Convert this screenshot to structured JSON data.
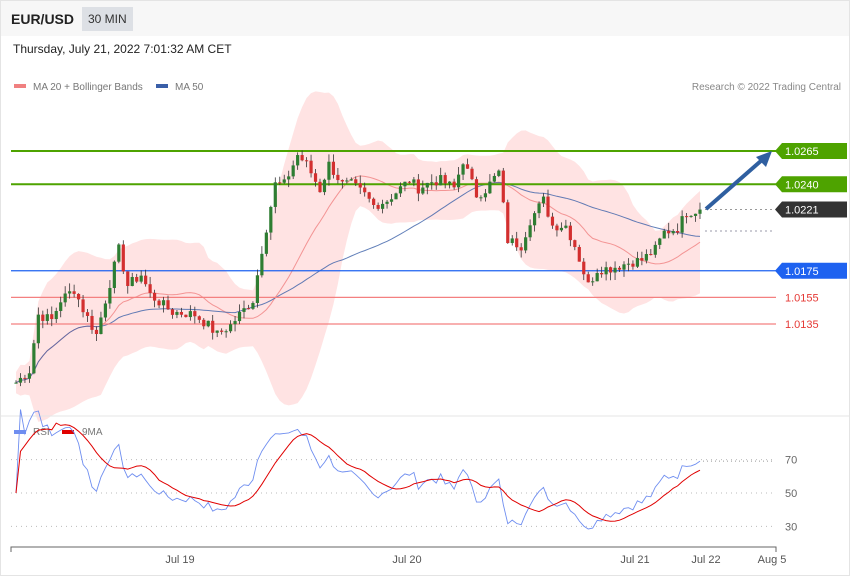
{
  "header": {
    "symbol": "EUR/USD",
    "timeframe": "30 MIN",
    "datetime": "Thursday, July 21, 2022 7:01:32 AM CET"
  },
  "colors": {
    "up": "#2e7d32",
    "down": "#d32f2f",
    "band": "#ffe3e3",
    "ma20": "#f08080",
    "ma50": "#3a5fa8",
    "resistance": "#4ea300",
    "support_blue": "#1e62f0",
    "support_red": "#f48080",
    "last": "#333333",
    "rsi": "#6f8ef0",
    "rsi_ma": "#e00000"
  },
  "chart_data": {
    "type": "candlestick",
    "legend": [
      {
        "name": "MA 20 + Bollinger Bands"
      },
      {
        "name": "MA 50"
      }
    ],
    "credit": "Research © 2022 Trading Central",
    "ylim": [
      1.0065,
      1.0285
    ],
    "closes": [
      1.0091,
      1.01,
      1.0142,
      1.0138,
      1.0153,
      1.0161,
      1.0146,
      1.0127,
      1.0153,
      1.0191,
      1.0164,
      1.0172,
      1.0157,
      1.0149,
      1.0144,
      1.0143,
      1.0142,
      1.0134,
      1.0127,
      1.0134,
      1.0142,
      1.0153,
      1.0191,
      1.024,
      1.024,
      1.0262,
      1.0255,
      1.0236,
      1.0255,
      1.024,
      1.024,
      1.0232,
      1.0224,
      1.0228,
      1.0234,
      1.0243,
      1.0237,
      1.0242,
      1.0243,
      1.0237,
      1.0258,
      1.0232,
      1.0236,
      1.0249,
      1.0198,
      1.0194,
      1.0213,
      1.0228,
      1.0209,
      1.0209,
      1.0194,
      1.0164,
      1.0176,
      1.0177,
      1.0179,
      1.0182,
      1.0183,
      1.0191,
      1.0204,
      1.0207,
      1.0219,
      1.0221
    ],
    "levels": [
      {
        "label": "1.0265",
        "value": 1.0265,
        "kind": "resistance"
      },
      {
        "label": "1.0240",
        "value": 1.024,
        "kind": "resistance"
      },
      {
        "label": "1.0221",
        "value": 1.0221,
        "kind": "last"
      },
      {
        "label": "1.0175",
        "value": 1.0175,
        "kind": "support_blue"
      },
      {
        "label": "1.0155",
        "value": 1.0155,
        "kind": "support_red"
      },
      {
        "label": "1.0135",
        "value": 1.0135,
        "kind": "support_red"
      }
    ],
    "target": 1.0265,
    "rsi": {
      "legend": [
        {
          "name": "RSI"
        },
        {
          "name": "9MA"
        }
      ],
      "ticks": [
        "70",
        "50",
        "30"
      ],
      "tick_values": [
        70,
        50,
        30
      ]
    },
    "xticks": [
      "Jul 19",
      "Jul 20",
      "Jul 21",
      "Jul 22",
      "Aug 5"
    ]
  }
}
